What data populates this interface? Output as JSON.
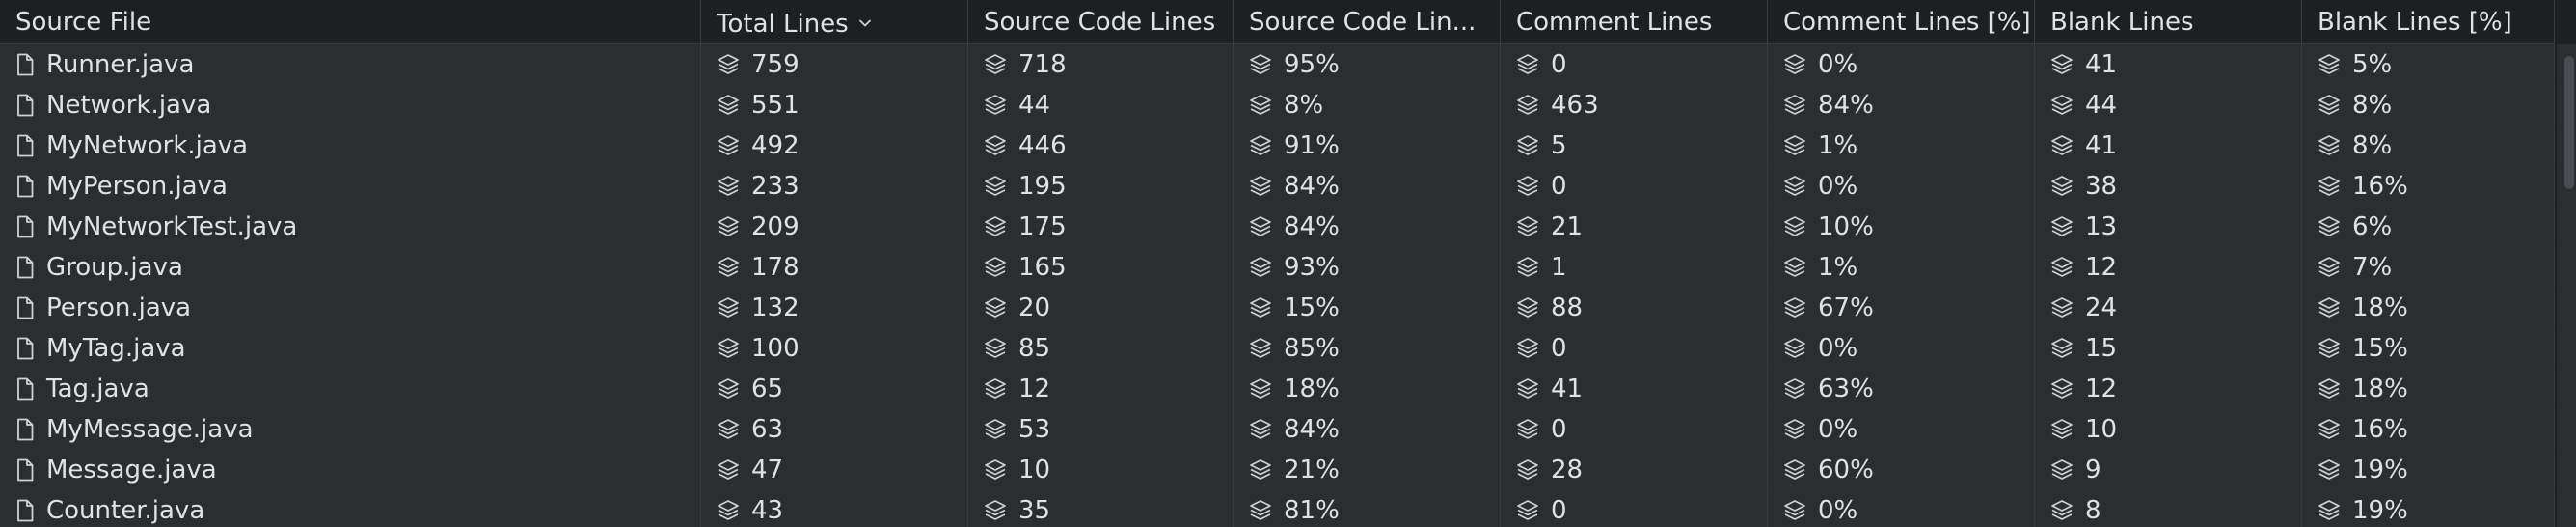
{
  "columns": [
    {
      "key": "file",
      "label": "Source File"
    },
    {
      "key": "total",
      "label": "Total Lines",
      "sorted": "desc"
    },
    {
      "key": "src",
      "label": "Source Code Lines"
    },
    {
      "key": "srcpct",
      "label": "Source Code Lin..."
    },
    {
      "key": "comm",
      "label": "Comment Lines"
    },
    {
      "key": "commpct",
      "label": "Comment Lines [%]"
    },
    {
      "key": "blank",
      "label": "Blank Lines"
    },
    {
      "key": "blankpct",
      "label": "Blank Lines [%]"
    }
  ],
  "icons": {
    "file": "file-icon",
    "metric": "layers-icon",
    "sort": "chevron-down-icon"
  },
  "rows": [
    {
      "file": "Runner.java",
      "total": "759",
      "src": "718",
      "srcpct": "95%",
      "comm": "0",
      "commpct": "0%",
      "blank": "41",
      "blankpct": "5%"
    },
    {
      "file": "Network.java",
      "total": "551",
      "src": "44",
      "srcpct": "8%",
      "comm": "463",
      "commpct": "84%",
      "blank": "44",
      "blankpct": "8%"
    },
    {
      "file": "MyNetwork.java",
      "total": "492",
      "src": "446",
      "srcpct": "91%",
      "comm": "5",
      "commpct": "1%",
      "blank": "41",
      "blankpct": "8%"
    },
    {
      "file": "MyPerson.java",
      "total": "233",
      "src": "195",
      "srcpct": "84%",
      "comm": "0",
      "commpct": "0%",
      "blank": "38",
      "blankpct": "16%"
    },
    {
      "file": "MyNetworkTest.java",
      "total": "209",
      "src": "175",
      "srcpct": "84%",
      "comm": "21",
      "commpct": "10%",
      "blank": "13",
      "blankpct": "6%"
    },
    {
      "file": "Group.java",
      "total": "178",
      "src": "165",
      "srcpct": "93%",
      "comm": "1",
      "commpct": "1%",
      "blank": "12",
      "blankpct": "7%"
    },
    {
      "file": "Person.java",
      "total": "132",
      "src": "20",
      "srcpct": "15%",
      "comm": "88",
      "commpct": "67%",
      "blank": "24",
      "blankpct": "18%"
    },
    {
      "file": "MyTag.java",
      "total": "100",
      "src": "85",
      "srcpct": "85%",
      "comm": "0",
      "commpct": "0%",
      "blank": "15",
      "blankpct": "15%"
    },
    {
      "file": "Tag.java",
      "total": "65",
      "src": "12",
      "srcpct": "18%",
      "comm": "41",
      "commpct": "63%",
      "blank": "12",
      "blankpct": "18%"
    },
    {
      "file": "MyMessage.java",
      "total": "63",
      "src": "53",
      "srcpct": "84%",
      "comm": "0",
      "commpct": "0%",
      "blank": "10",
      "blankpct": "16%"
    },
    {
      "file": "Message.java",
      "total": "47",
      "src": "10",
      "srcpct": "21%",
      "comm": "28",
      "commpct": "60%",
      "blank": "9",
      "blankpct": "19%"
    },
    {
      "file": "Counter.java",
      "total": "43",
      "src": "35",
      "srcpct": "81%",
      "comm": "0",
      "commpct": "0%",
      "blank": "8",
      "blankpct": "19%"
    }
  ]
}
